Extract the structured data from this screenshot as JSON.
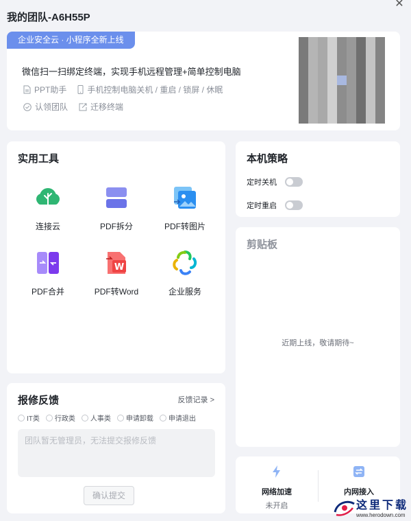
{
  "window": {
    "title": "我的团队-A6H55P"
  },
  "promo": {
    "badge": "企业安全云 · 小程序全新上线",
    "headline": "微信扫一扫绑定终端，实现手机远程管理+简单控制电脑",
    "features": [
      {
        "label": "PPT助手",
        "icon": "document-icon"
      },
      {
        "label": "手机控制电脑关机 / 重启 / 锁屏 / 休眠",
        "icon": "phone-icon"
      }
    ],
    "actions": [
      {
        "label": "认领团队",
        "icon": "check-circle-icon"
      },
      {
        "label": "迁移终端",
        "icon": "migrate-icon"
      }
    ]
  },
  "tools": {
    "title": "实用工具",
    "items": [
      {
        "label": "连接云",
        "icon": "cloud-tree-icon"
      },
      {
        "label": "PDF拆分",
        "icon": "pdf-split-icon"
      },
      {
        "label": "PDF转图片",
        "icon": "pdf-to-image-icon"
      },
      {
        "label": "PDF合并",
        "icon": "pdf-merge-icon"
      },
      {
        "label": "PDF转Word",
        "icon": "pdf-to-word-icon"
      },
      {
        "label": "企业服务",
        "icon": "enterprise-service-icon"
      }
    ]
  },
  "policy": {
    "title": "本机策略",
    "items": [
      {
        "label": "定时关机",
        "on": false
      },
      {
        "label": "定时重启",
        "on": false
      }
    ]
  },
  "clipboard": {
    "title": "剪贴板",
    "message": "近期上线，敬请期待~"
  },
  "feedback": {
    "title": "报修反馈",
    "history_link": "反馈记录 >",
    "categories": [
      "IT类",
      "行政类",
      "人事类",
      "申请卸载",
      "申请退出"
    ],
    "placeholder": "团队暂无管理员，无法提交报修反馈",
    "submit": "确认提交"
  },
  "network": {
    "items": [
      {
        "label": "网络加速",
        "status": "未开启",
        "icon": "lightning-icon"
      },
      {
        "label": "内网接入",
        "status": "",
        "icon": "intranet-icon"
      }
    ]
  },
  "watermark": {
    "text": "这里下载",
    "url": "www.herodown.com"
  },
  "colors": {
    "accent": "#6b8fec",
    "green": "#3cb371",
    "purple": "#8b5cf6",
    "red": "#ef4444"
  }
}
